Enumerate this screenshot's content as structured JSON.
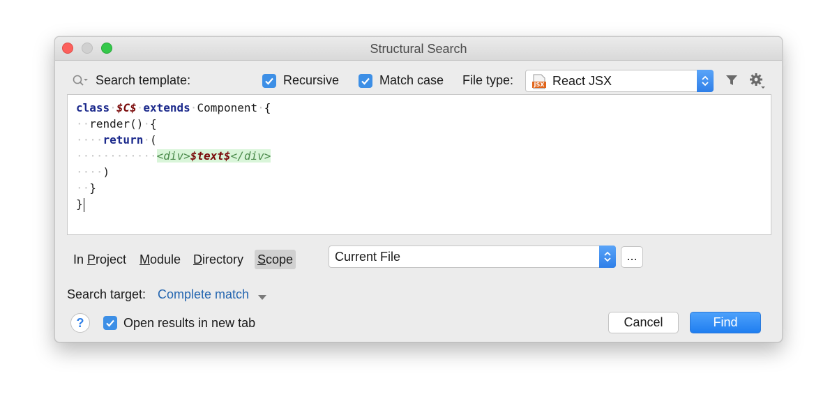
{
  "window": {
    "title": "Structural Search"
  },
  "toolbar": {
    "search_template_label": "Search template:",
    "recursive_label": "Recursive",
    "recursive_checked": true,
    "match_case_label": "Match case",
    "match_case_checked": true,
    "file_type_label": "File type:",
    "file_type_value": "React JSX",
    "file_type_icon_text": "JSX",
    "icons": {
      "search": "search-icon",
      "filter": "filter-icon",
      "settings": "gear-icon"
    }
  },
  "editor": {
    "lines": [
      "class $C$ extends Component {",
      "  render() {",
      "    return (",
      "      <div>$text$</div>",
      "    )",
      "  }",
      "}"
    ]
  },
  "scope": {
    "in_project": "In Project",
    "module": "Module",
    "directory": "Directory",
    "scope": "Scope",
    "selected_tab": "Scope",
    "value": "Current File",
    "browse_label": "..."
  },
  "target": {
    "label": "Search target:",
    "value": "Complete match"
  },
  "footer": {
    "help_label": "?",
    "open_new_tab_label": "Open results in new tab",
    "open_new_tab_checked": true,
    "cancel_label": "Cancel",
    "find_label": "Find"
  },
  "colors": {
    "accent": "#2f7fe8",
    "keyword": "#1c2a8c",
    "variable": "#7a0a0a",
    "jsx_tag": "#4a8a4a",
    "jsx_background": "#d9f5d9"
  }
}
